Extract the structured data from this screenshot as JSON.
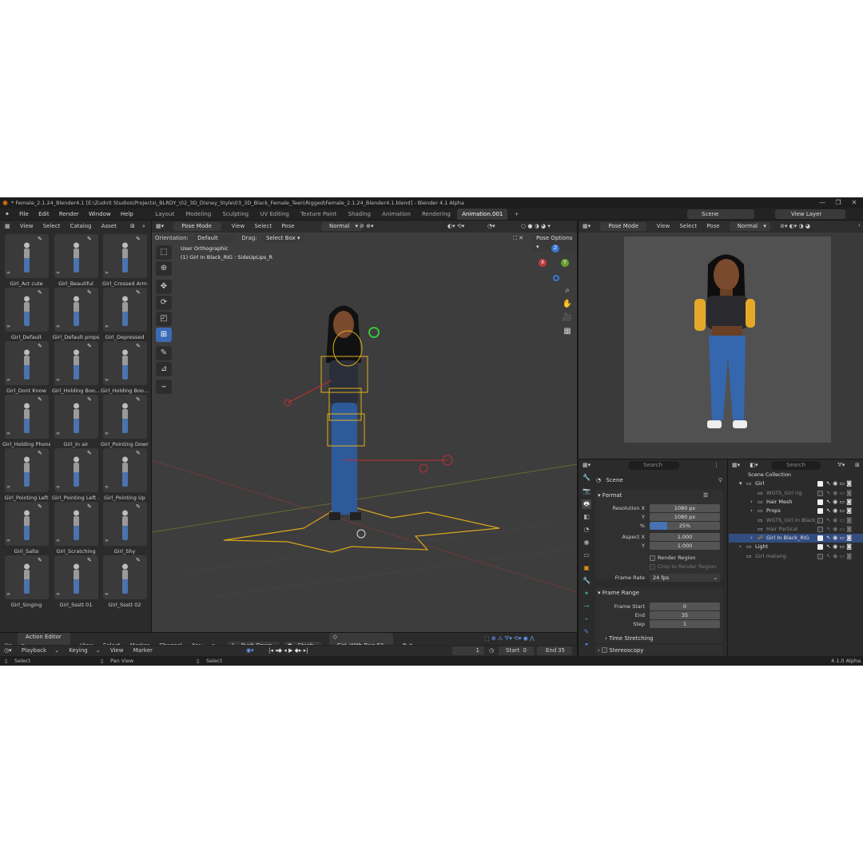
{
  "window": {
    "title": "* Female_2.1.24_Blender4.1 [E:\\Zudnit Studios\\Projects\\_BLRDY_\\02_3D_Disney_Style\\03_3D_Black_Female_Teen\\Rigged\\Female_2.1.24_Blender4.1.blend] - Blender 4.1 Alpha",
    "minimize": "—",
    "maximize": "❐",
    "close": "✕"
  },
  "menubar": {
    "logo": "blender-logo",
    "menus": [
      "File",
      "Edit",
      "Render",
      "Window",
      "Help"
    ],
    "workspaces": [
      "Layout",
      "Modeling",
      "Sculpting",
      "UV Editing",
      "Texture Paint",
      "Shading",
      "Animation",
      "Rendering",
      "Animation.001"
    ],
    "active_workspace": "Animation.001",
    "add_workspace": "+",
    "scene_value": "Scene",
    "view_layer_value": "View Layer"
  },
  "asset_browser": {
    "menus": [
      "View",
      "Select",
      "Catalog",
      "Asset"
    ],
    "assets": [
      "Girl_Act cute",
      "Girl_Beautiful",
      "Girl_Crossed Arm",
      "Girl_Default",
      "Girl_Default props",
      "Girl_Depressed",
      "Girl_Dont Know",
      "Girl_Holding Boo...",
      "Girl_Holding Boo...",
      "Girl_Holding Phone",
      "Girl_In air",
      "Girl_Pointing Down",
      "Girl_Pointing Left",
      "Girl_Pointing Left ...",
      "Girl_Pointing Up",
      "Girl_Salto",
      "Girl_Scratching",
      "Girl_Shy",
      "Girl_Singing",
      "Girl_Ssstt 01",
      "Girl_Ssstt 02"
    ]
  },
  "viewport": {
    "mode": "Pose Mode",
    "menus": [
      "View",
      "Select",
      "Pose"
    ],
    "orientation_label": "Orientation:",
    "orientation_value": "Default",
    "drag_label": "Drag:",
    "drag_value": "Select Box",
    "transform_pivot": "Normal",
    "pose_options": "Pose Options",
    "overlay_title": "User Orthographic",
    "overlay_subtitle": "(1) Girl In Black_RIG : SideUpLips_R",
    "gizmo_axes": [
      "Z",
      "Y",
      "X"
    ]
  },
  "render_view": {
    "mode": "Pose Mode",
    "menus": [
      "View",
      "Select",
      "Pose"
    ],
    "shading": "Normal"
  },
  "properties": {
    "search_placeholder": "Search",
    "context": "Scene",
    "format_title": "Format",
    "resolution_x_label": "Resolution X",
    "resolution_x": "1080 px",
    "resolution_y_label": "Y",
    "resolution_y": "1080 px",
    "percent_label": "%",
    "percent_value": "25%",
    "percent_fraction": 0.25,
    "aspect_x_label": "Aspect X",
    "aspect_x": "1.000",
    "aspect_y_label": "Y",
    "aspect_y": "1.000",
    "render_region": "Render Region",
    "crop_region": "Crop to Render Region",
    "frame_rate_label": "Frame Rate",
    "frame_rate": "24 fps",
    "frame_range_title": "Frame Range",
    "frame_start_label": "Frame Start",
    "frame_start": "0",
    "frame_end_label": "End",
    "frame_end": "35",
    "step_label": "Step",
    "step": "1",
    "time_stretching": "Time Stretching",
    "stereoscopy": "Stereoscopy"
  },
  "outliner": {
    "search_placeholder": "Search",
    "items": [
      {
        "label": "Scene Collection",
        "dim": false
      },
      {
        "label": "Girl",
        "dim": false
      },
      {
        "label": "WGTS_Girl rig",
        "dim": true
      },
      {
        "label": "Hair Mesh",
        "dim": false
      },
      {
        "label": "Props",
        "dim": false
      },
      {
        "label": "WGTS_Girl In Black_I",
        "dim": true
      },
      {
        "label": "Hair Partical",
        "dim": true
      },
      {
        "label": "Girl In Black_RIG",
        "dim": false
      },
      {
        "label": "Light",
        "dim": false
      },
      {
        "label": "Girl metarig",
        "dim": true
      }
    ]
  },
  "action_editor": {
    "editor": "Action Editor",
    "menus": [
      "View",
      "Select",
      "Marker",
      "Channel",
      "Key"
    ],
    "push_down": "Push Down",
    "stash": "Stash",
    "action_name": "Girl_With Bag 03"
  },
  "timeline": {
    "menus": [
      "Playback",
      "Keying",
      "View",
      "Marker"
    ],
    "current_frame": "1",
    "start_label": "Start",
    "start": "0",
    "end_label": "End",
    "end": "35"
  },
  "statusbar": {
    "items": [
      "Select",
      "Pan View",
      "Select"
    ],
    "version": "4.1.0 Alpha"
  }
}
